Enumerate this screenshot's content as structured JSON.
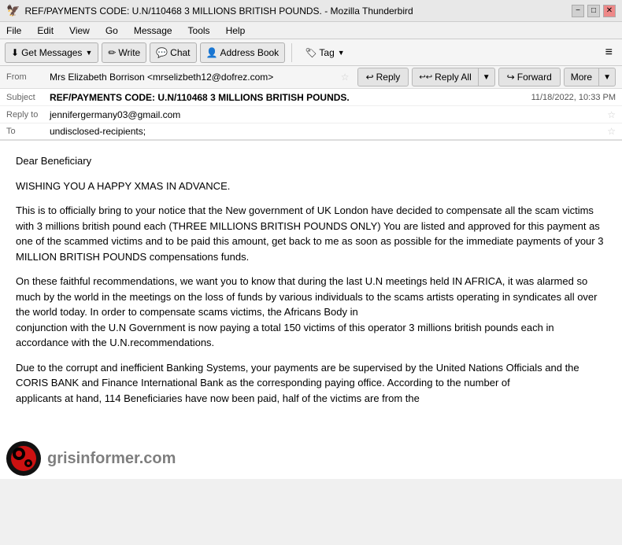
{
  "titlebar": {
    "title": "REF/PAYMENTS CODE: U.N/110468 3 MILLIONS BRITISH POUNDS. - Mozilla Thunderbird",
    "minimize": "−",
    "maximize": "□",
    "close": "✕"
  },
  "menubar": {
    "items": [
      "File",
      "Edit",
      "View",
      "Go",
      "Message",
      "Tools",
      "Help"
    ]
  },
  "toolbar": {
    "get_messages": "Get Messages",
    "write": "Write",
    "chat": "Chat",
    "address_book": "Address Book",
    "tag": "Tag"
  },
  "email_header": {
    "from_label": "From",
    "from_value": "Mrs Elizabeth Borrison <mrselizbeth12@dofrez.com>",
    "subject_label": "Subject",
    "subject_value": "REF/PAYMENTS CODE: U.N/110468 3 MILLIONS BRITISH POUNDS.",
    "reply_to_label": "Reply to",
    "reply_to_value": "jennifergermany03@gmail.com",
    "to_label": "To",
    "to_value": "undisclosed-recipients;",
    "date": "11/18/2022, 10:33 PM"
  },
  "actions": {
    "reply": "Reply",
    "reply_all": "Reply All",
    "forward": "Forward",
    "more": "More"
  },
  "email_body": {
    "p1": "Dear Beneficiary",
    "p2": "WISHING YOU A HAPPY XMAS IN ADVANCE.",
    "p3": "This is to officially bring to your notice that the New government of UK London have decided to compensate all the scam victims with 3 millions british pound each (THREE MILLIONS BRITISH POUNDS ONLY) You are listed and approved for this payment as one of the scammed victims and to be paid this amount, get back to me as soon as possible for the immediate payments of your 3 MILLION BRITISH POUNDS compensations funds.",
    "p4": "On these faithful recommendations, we want you to know that during the last U.N meetings held IN AFRICA, it was alarmed so much by the world in the meetings on the loss of funds by various individuals to the scams artists operating in syndicates all over the world today. In order to compensate scams victims, the Africans Body in",
    "p4b": "conjunction with the U.N Government is now paying a total 150 victims of this operator 3 millions british pounds each in accordance with the U.N.recommendations.",
    "p5": "Due to the corrupt and inefficient Banking Systems, your payments are be supervised by the United Nations Officials and the CORIS BANK and Finance International Bank as the corresponding paying office. According to the number of",
    "p5b": "applicants at hand, 114 Beneficiaries have now been paid, half of the victims are from the"
  }
}
